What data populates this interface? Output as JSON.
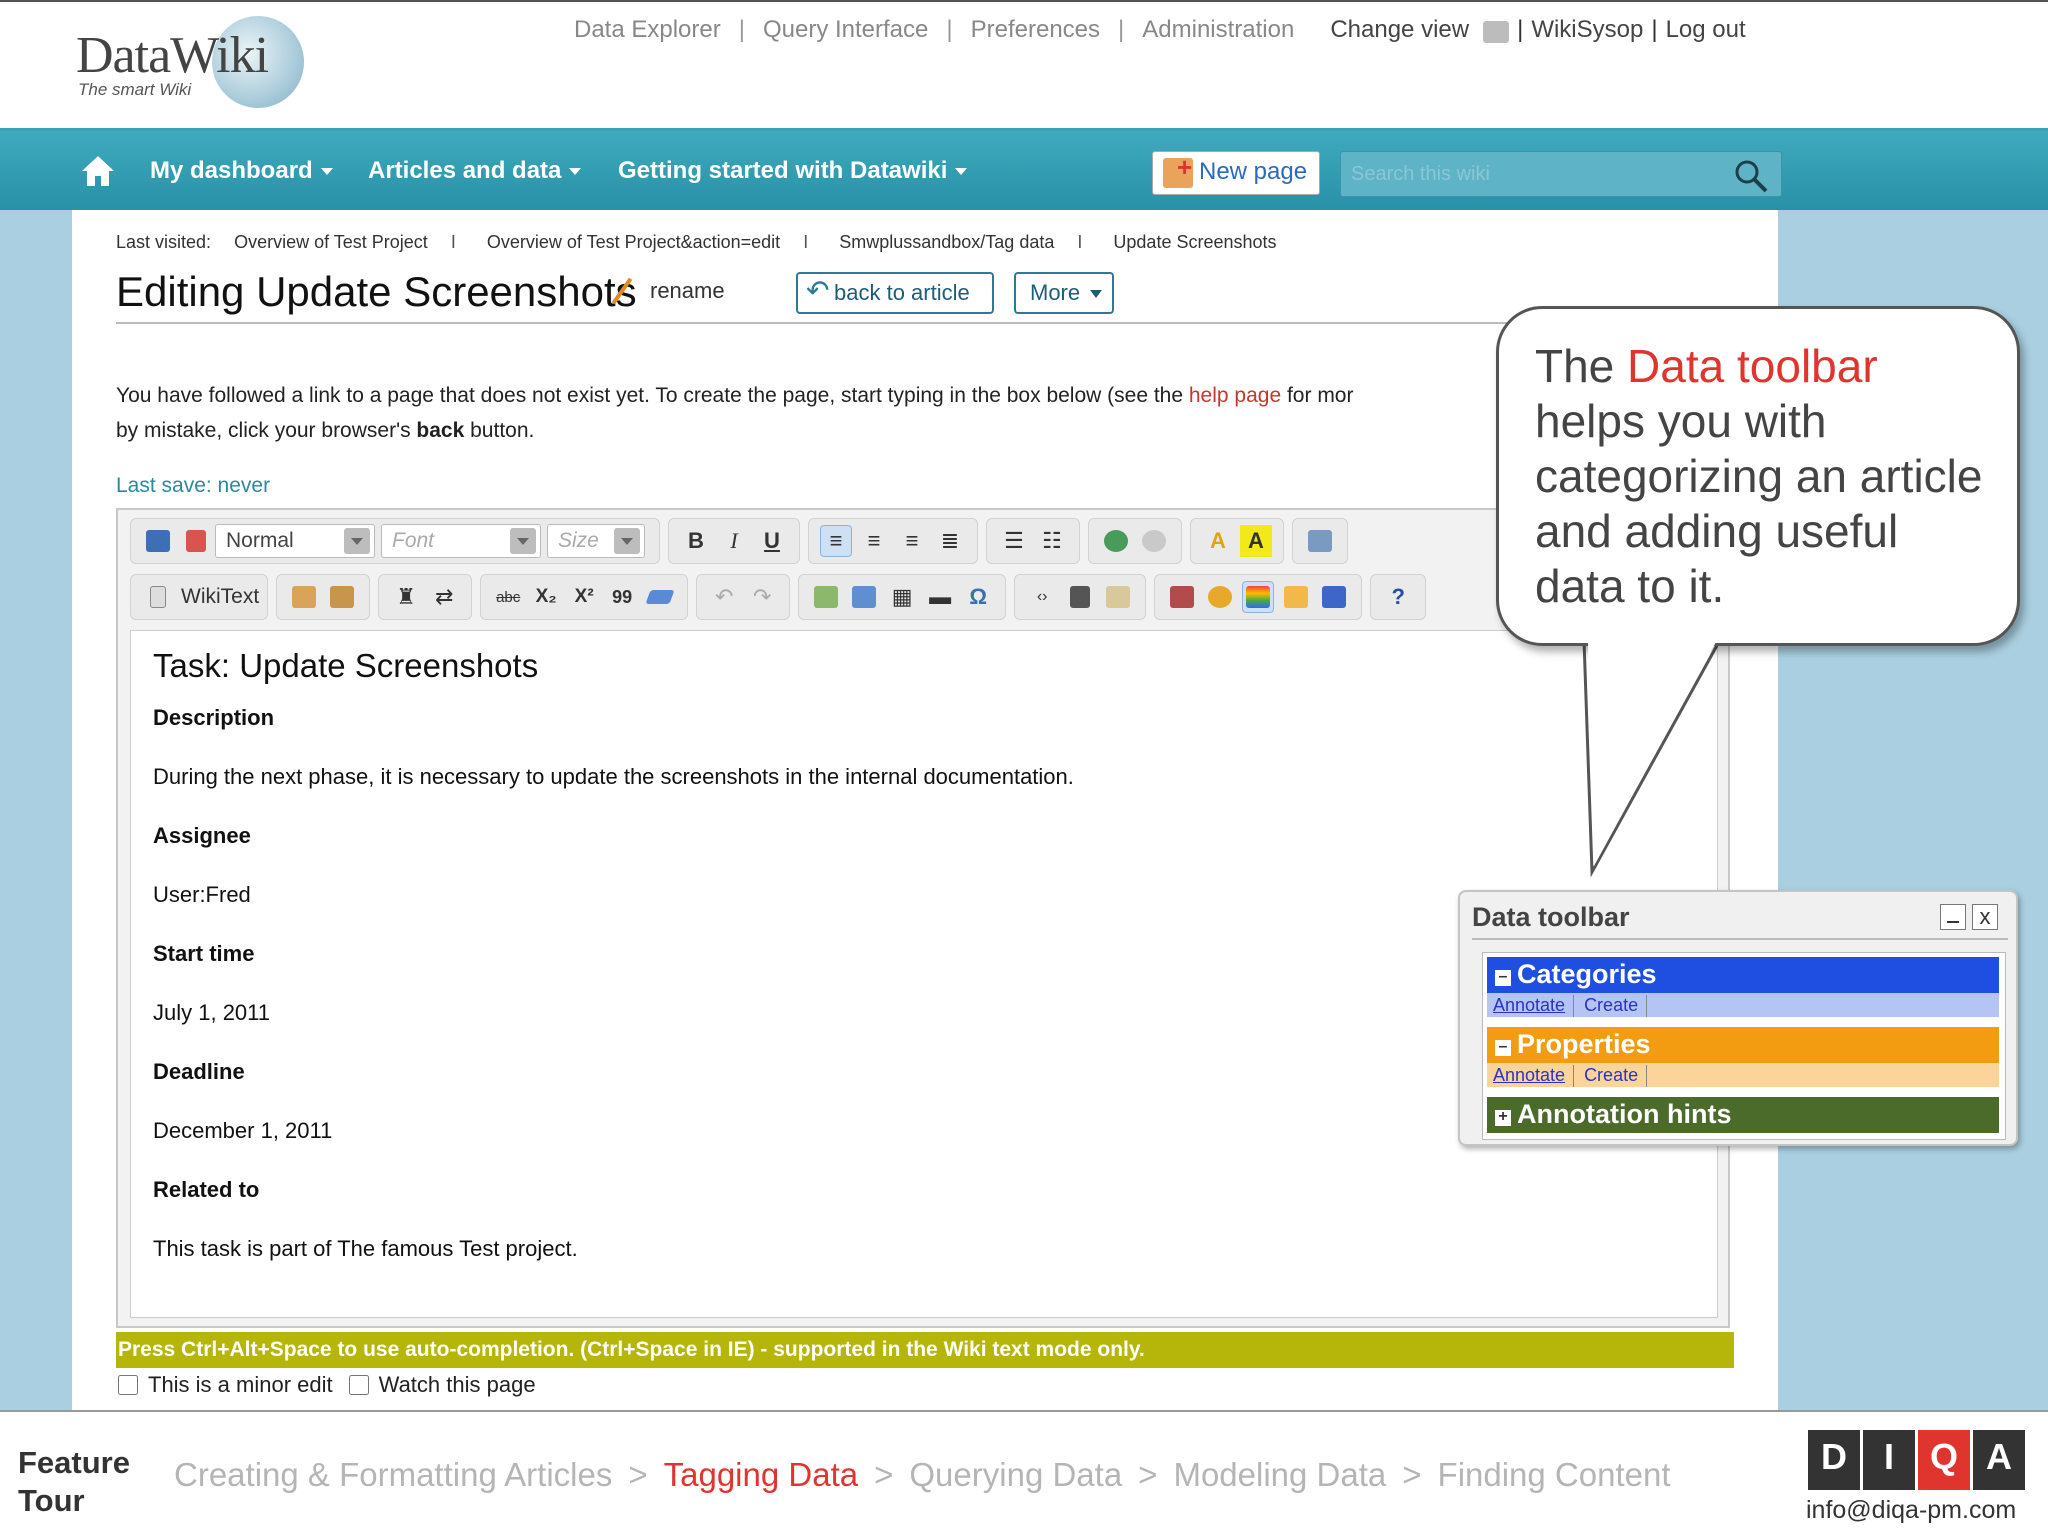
{
  "logo": {
    "name": "DataWiki",
    "tagline": "The smart Wiki"
  },
  "top_links": {
    "data_explorer": "Data Explorer",
    "query_interface": "Query Interface",
    "preferences": "Preferences",
    "administration": "Administration",
    "change_view": "Change view",
    "user": "WikiSysop",
    "log_out": "Log out",
    "separator": "|"
  },
  "nav": {
    "my_dashboard": "My dashboard",
    "articles_and_data": "Articles and data",
    "getting_started": "Getting started with Datawiki",
    "new_page": "New page",
    "search_placeholder": "Search this wiki"
  },
  "last_visited": {
    "label": "Last visited:",
    "items": [
      "Overview of Test Project",
      "Overview of Test Project&action=edit",
      "Smwplussandbox/Tag data",
      "Update Screenshots"
    ],
    "separator": "I"
  },
  "page": {
    "title": "Editing Update Screenshots",
    "rename": "rename",
    "back_to_article": "back to article",
    "more": "More",
    "intro_line1_a": "You have followed a link to a page that does not exist yet. To create the page, start typing in the box below (see the ",
    "intro_help": "help page",
    "intro_line1_b": " for mor",
    "intro_line2_a": "by mistake, click your browser's ",
    "intro_back": "back",
    "intro_line2_b": " button.",
    "last_save": "Last save: never"
  },
  "toolbar": {
    "format_value": "Normal",
    "font_placeholder": "Font",
    "size_placeholder": "Size",
    "bold": "B",
    "italic": "I",
    "underline": "U",
    "wikitext": "WikiText",
    "strike": "abc",
    "subscript": "X₂",
    "superscript": "X²",
    "quote": "99",
    "omega": "Ω",
    "help": "?"
  },
  "editor_content": {
    "heading": "Task: Update Screenshots",
    "description_label": "Description",
    "description_text": "During the next phase, it is necessary to update the screenshots in the internal documentation.",
    "assignee_label": "Assignee",
    "assignee_value": "User:Fred",
    "start_label": "Start time",
    "start_value": "July 1, 2011",
    "deadline_label": "Deadline",
    "deadline_value": "December 1, 2011",
    "related_label": "Related to",
    "related_value": "This task is part of The famous Test project."
  },
  "hint_bar": "Press Ctrl+Alt+Space to use auto-completion. (Ctrl+Space in IE) - supported in the Wiki text mode only.",
  "checkboxes": {
    "minor_edit": "This is a minor edit",
    "watch": "Watch this page"
  },
  "callout": {
    "text_a": "The ",
    "highlight": "Data toolbar",
    "text_b": " helps you with categorizing an article and adding useful data to it."
  },
  "data_toolbar": {
    "title": "Data toolbar",
    "close": "x",
    "categories": {
      "label": "Categories",
      "annotate": "Annotate",
      "create": "Create",
      "color": "#1f4fe0"
    },
    "properties": {
      "label": "Properties",
      "annotate": "Annotate",
      "create": "Create",
      "color": "#f39c12"
    },
    "hints": {
      "label": "Annotation hints",
      "color": "#4a6b2a"
    }
  },
  "footer": {
    "label": "Feature Tour",
    "steps": [
      "Creating & Formatting Articles",
      "Tagging Data",
      "Querying Data",
      "Modeling Data",
      "Finding Content"
    ],
    "active_step": "Tagging Data",
    "separator": ">",
    "brand_letters": [
      "D",
      "I",
      "Q",
      "A"
    ],
    "email": "info@diqa-pm.com"
  },
  "colors": {
    "nav": "#2f9db3",
    "accent_red": "#e0342f",
    "hint_bar": "#b6b60a"
  }
}
